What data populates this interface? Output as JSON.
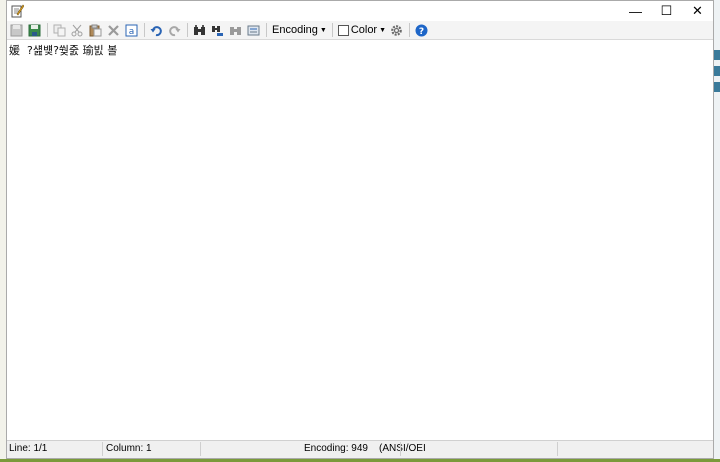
{
  "window": {
    "controls": {
      "minimize": "—",
      "maximize": "☐",
      "close": "✕"
    }
  },
  "toolbar": {
    "encoding_label": "Encoding",
    "color_label": "Color"
  },
  "editor": {
    "content": "媛  ?섎뱾?쒖줈 瑜빐 볼"
  },
  "status": {
    "line": "Line: 1/1",
    "column": "Column: 1",
    "encoding": "Encoding: 949    (ANSI/OEI"
  },
  "colors": {
    "help_blue": "#1e66c8",
    "undo_blue": "#2a64b4",
    "delete_red": "#c83a2a"
  }
}
